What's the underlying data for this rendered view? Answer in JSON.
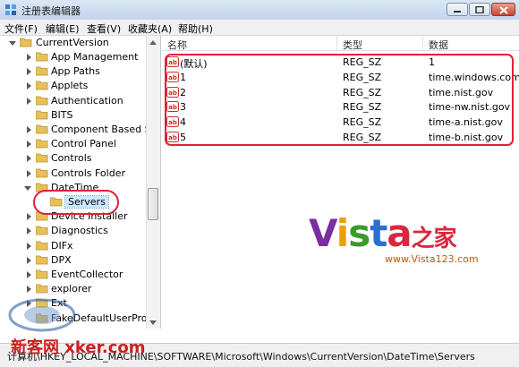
{
  "window": {
    "title": "注册表编辑器"
  },
  "menu": [
    "文件(F)",
    "编辑(E)",
    "查看(V)",
    "收藏夹(A)",
    "帮助(H)"
  ],
  "tree": {
    "parent": "CurrentVersion",
    "items": [
      {
        "label": "App Management",
        "expand": "closed"
      },
      {
        "label": "App Paths",
        "expand": "closed"
      },
      {
        "label": "Applets",
        "expand": "closed"
      },
      {
        "label": "Authentication",
        "expand": "closed"
      },
      {
        "label": "BITS",
        "expand": "none"
      },
      {
        "label": "Component Based Ser",
        "expand": "closed"
      },
      {
        "label": "Control Panel",
        "expand": "closed"
      },
      {
        "label": "Controls",
        "expand": "closed"
      },
      {
        "label": "Controls Folder",
        "expand": "closed"
      },
      {
        "label": "DateTime",
        "expand": "open"
      },
      {
        "label": "Servers",
        "expand": "none",
        "child": true,
        "selected": true
      },
      {
        "label": "Device Installer",
        "expand": "closed"
      },
      {
        "label": "Diagnostics",
        "expand": "closed"
      },
      {
        "label": "DIFx",
        "expand": "closed"
      },
      {
        "label": "DPX",
        "expand": "closed"
      },
      {
        "label": "EventCollector",
        "expand": "closed"
      },
      {
        "label": "explorer",
        "expand": "closed"
      },
      {
        "label": "Ext",
        "expand": "closed"
      },
      {
        "label": "FakeDefaultUserProfile",
        "expand": "none"
      }
    ]
  },
  "list": {
    "headers": [
      "名称",
      "类型",
      "数据"
    ],
    "rows": [
      {
        "name": "(默认)",
        "type": "REG_SZ",
        "data": "1"
      },
      {
        "name": "1",
        "type": "REG_SZ",
        "data": "time.windows.com"
      },
      {
        "name": "2",
        "type": "REG_SZ",
        "data": "time.nist.gov"
      },
      {
        "name": "3",
        "type": "REG_SZ",
        "data": "time-nw.nist.gov"
      },
      {
        "name": "4",
        "type": "REG_SZ",
        "data": "time-a.nist.gov"
      },
      {
        "name": "5",
        "type": "REG_SZ",
        "data": "time-b.nist.gov"
      }
    ],
    "value_icon_text": "ab"
  },
  "status": "计算机\\HKEY_LOCAL_MACHINE\\SOFTWARE\\Microsoft\\Windows\\CurrentVersion\\DateTime\\Servers",
  "watermark": {
    "vista_letters": [
      "V",
      "i",
      "s",
      "t",
      "a"
    ],
    "vista_suffix": "之家",
    "vista_url": "www.Vista123.com",
    "xker": "新客网 xker.com"
  },
  "colors": {
    "highlight": "#e0203a",
    "selection": "#cde8ff",
    "folder": "#e8c05a"
  }
}
